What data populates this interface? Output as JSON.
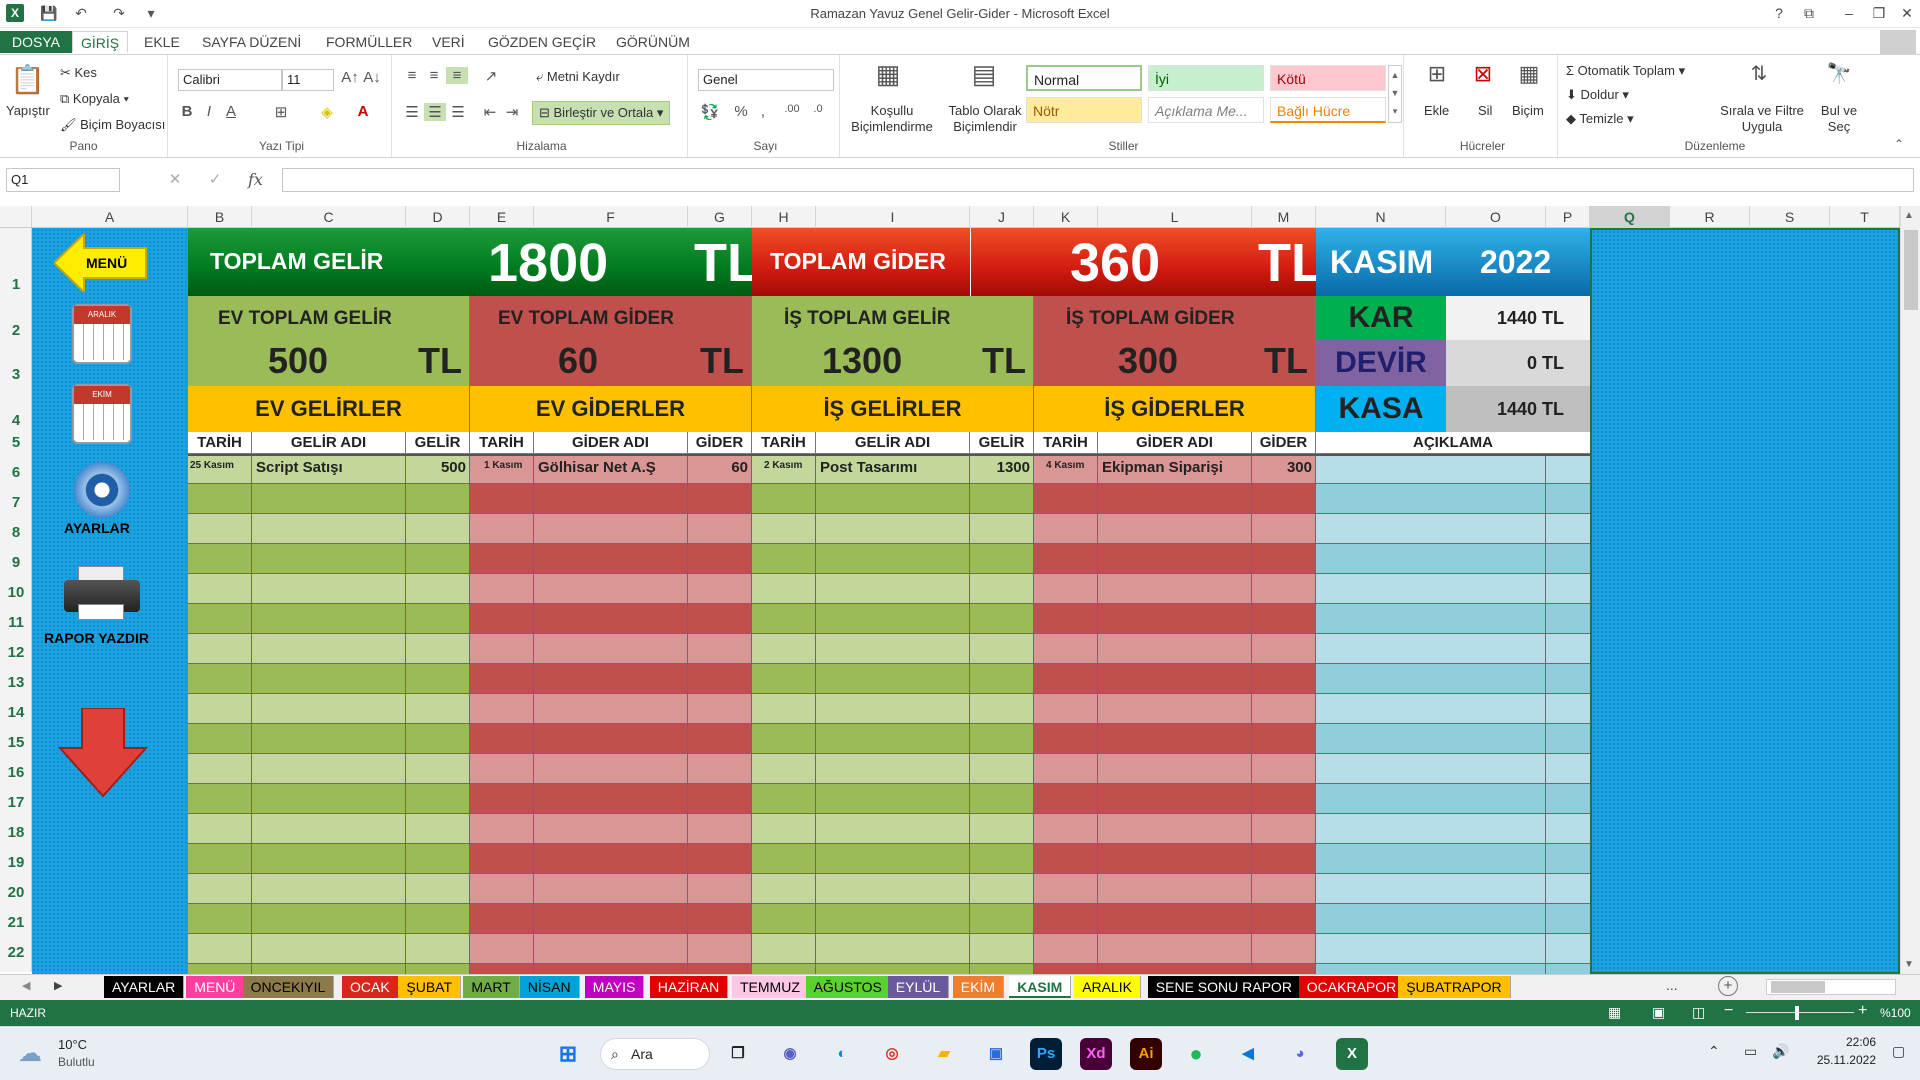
{
  "window": {
    "title": "Ramazan Yavuz Genel Gelir-Gider - Microsoft Excel",
    "controls": [
      "?",
      "⧉",
      "–",
      "❐",
      "✕"
    ]
  },
  "menu": {
    "tabs": [
      "DOSYA",
      "GİRİŞ",
      "EKLE",
      "SAYFA DÜZENİ",
      "FORMÜLLER",
      "VERİ",
      "GÖZDEN GEÇİR",
      "GÖRÜNÜM"
    ],
    "active": "GİRİŞ"
  },
  "ribbon": {
    "pano": {
      "label": "Pano",
      "paste": "Yapıştır",
      "cut": "Kes",
      "copy": "Kopyala",
      "painter": "Biçim Boyacısı"
    },
    "font": {
      "label": "Yazı Tipi",
      "name": "Calibri",
      "size": "11"
    },
    "align": {
      "label": "Hizalama",
      "wrap": "Metni Kaydır",
      "merge": "Birleştir ve Ortala"
    },
    "number": {
      "label": "Sayı",
      "format": "Genel"
    },
    "styles": {
      "label": "Stiller",
      "conditional": "Koşullu Biçimlendirme",
      "table": "Tablo Olarak Biçimlendir",
      "normal": "Normal",
      "good": "İyi",
      "bad": "Kötü",
      "neutral": "Nötr",
      "note": "Açıklama Me...",
      "linked": "Bağlı Hücre"
    },
    "cells": {
      "label": "Hücreler",
      "insert": "Ekle",
      "delete": "Sil",
      "format": "Biçim"
    },
    "edit": {
      "label": "Düzenleme",
      "autosum": "Otomatik Toplam",
      "fill": "Doldur",
      "clear": "Temizle",
      "sort": "Sırala ve Filtre Uygula",
      "find": "Bul ve Seç"
    }
  },
  "formula_bar": {
    "name_box": "Q1",
    "fx": "fx",
    "value": ""
  },
  "columns": [
    "A",
    "B",
    "C",
    "D",
    "E",
    "F",
    "G",
    "H",
    "I",
    "J",
    "K",
    "L",
    "M",
    "N",
    "O",
    "P",
    "Q",
    "R",
    "S",
    "T"
  ],
  "rows": [
    "1",
    "2",
    "3",
    "4",
    "5",
    "6",
    "7",
    "8",
    "9",
    "10",
    "11",
    "12",
    "13",
    "14",
    "15",
    "16",
    "17",
    "18",
    "19",
    "20",
    "21",
    "22"
  ],
  "sidebar": {
    "menu": "MENÜ",
    "aralik": "ARALIK",
    "ekim": "EKİM",
    "settings": "AYARLAR",
    "print": "RAPOR YAZDIR"
  },
  "summary": {
    "total_income_label": "TOPLAM GELİR",
    "total_income": "1800",
    "currency": "TL",
    "total_expense_label": "TOPLAM GİDER",
    "total_expense": "360",
    "month": "KASIM",
    "year": "2022",
    "home_income_label": "EV TOPLAM GELİR",
    "home_income": "500",
    "home_expense_label": "EV TOPLAM GİDER",
    "home_expense": "60",
    "work_income_label": "İŞ TOPLAM GELİR",
    "work_income": "1300",
    "work_expense_label": "İŞ TOPLAM GİDER",
    "work_expense": "300",
    "kar_label": "KAR",
    "kar": "1440 TL",
    "devir_label": "DEVİR",
    "devir": "0 TL",
    "kasa_label": "KASA",
    "kasa": "1440 TL"
  },
  "sections": {
    "home_income": "EV GELİRLER",
    "home_expense": "EV GİDERLER",
    "work_income": "İŞ GELİRLER",
    "work_expense": "İŞ GİDERLER"
  },
  "headers": {
    "date": "TARİH",
    "income_name": "GELİR ADI",
    "income": "GELİR",
    "expense_name": "GİDER ADI",
    "expense": "GİDER",
    "note": "AÇIKLAMA"
  },
  "entries": {
    "home_income": {
      "date": "25 Kasım",
      "name": "Script Satışı",
      "amount": "500"
    },
    "home_expense": {
      "date": "1 Kasım",
      "name": "Gölhisar Net A.Ş",
      "amount": "60"
    },
    "work_income": {
      "date": "2 Kasım",
      "name": "Post Tasarımı",
      "amount": "1300"
    },
    "work_expense": {
      "date": "4 Kasım",
      "name": "Ekipman Siparişi",
      "amount": "300"
    }
  },
  "sheet_tabs": [
    {
      "name": "AYARLAR",
      "bg": "#000000",
      "fg": "#ffffff"
    },
    {
      "name": "MENÜ",
      "bg": "#ff3fa0",
      "fg": "#ffffff"
    },
    {
      "name": "ONCEKIYIL",
      "bg": "#8c7a4a",
      "fg": "#000000"
    },
    {
      "name": "OCAK",
      "bg": "#d9261c",
      "fg": "#ffffff"
    },
    {
      "name": "ŞUBAT",
      "bg": "#ffc000",
      "fg": "#000000"
    },
    {
      "name": "MART",
      "bg": "#70ad47",
      "fg": "#000000"
    },
    {
      "name": "NİSAN",
      "bg": "#00a2d8",
      "fg": "#000000"
    },
    {
      "name": "MAYIS",
      "bg": "#c000c0",
      "fg": "#ffffff"
    },
    {
      "name": "HAZİRAN",
      "bg": "#e00000",
      "fg": "#ffffff"
    },
    {
      "name": "TEMMUZ",
      "bg": "#ffc6e6",
      "fg": "#000000"
    },
    {
      "name": "AĞUSTOS",
      "bg": "#5bd12f",
      "fg": "#000000"
    },
    {
      "name": "EYLÜL",
      "bg": "#6a5a9c",
      "fg": "#ffffff"
    },
    {
      "name": "EKİM",
      "bg": "#ed7d31",
      "fg": "#ffffff"
    },
    {
      "name": "KASIM",
      "bg": "#ffffff",
      "fg": "#217346"
    },
    {
      "name": "ARALIK",
      "bg": "#ffff00",
      "fg": "#000000"
    },
    {
      "name": "SENE SONU RAPOR",
      "bg": "#000000",
      "fg": "#ffffff"
    },
    {
      "name": "OCAKRAPOR",
      "bg": "#e00000",
      "fg": "#ffffff"
    },
    {
      "name": "ŞUBATRAPOR",
      "bg": "#ffc000",
      "fg": "#000000"
    }
  ],
  "status": {
    "ready": "HAZIR",
    "zoom": "%100"
  },
  "taskbar": {
    "weather_temp": "10°C",
    "weather_desc": "Bulutlu",
    "search": "Ara",
    "time": "22:06",
    "date": "25.11.2022"
  },
  "colors": {
    "accent": "#217346",
    "sheet_bg": "#1aa3e0",
    "green": "#9bbb59",
    "red": "#c0504d",
    "orange": "#ffc000"
  }
}
